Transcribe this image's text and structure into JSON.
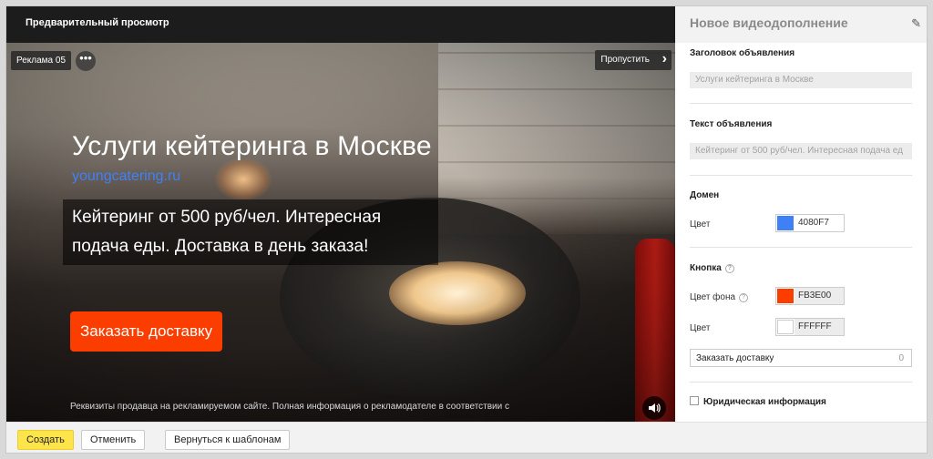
{
  "preview": {
    "header_title": "Предварительный просмотр",
    "ad_badge": "Реклама 05",
    "more_glyph": "•••",
    "skip_label": "Пропустить",
    "skip_icon": "chevron-right-icon",
    "title": "Услуги кейтеринга в Москве",
    "domain": "youngcatering.ru",
    "text": "Кейтеринг от 500 руб/чел. Интересная подача еды. Доставка в день заказа!",
    "cta": "Заказать доставку",
    "legal": "Реквизиты продавца на рекламируемом сайте. Полная информация о рекламодателе в соответствии с",
    "sound_icon": "speaker-icon"
  },
  "panel": {
    "title": "Новое видеодополнение",
    "edit_icon": "pencil-icon",
    "headline_label": "Заголовок объявления",
    "headline_placeholder": "Услуги кейтеринга в Москве",
    "text_label": "Текст объявления",
    "text_placeholder": "Кейтеринг от 500 руб/чел. Интересная подача ед",
    "domain_section": "Домен",
    "domain_color_label": "Цвет",
    "domain_color": "4080F7",
    "button_section": "Кнопка",
    "bg_color_label": "Цвет фона",
    "bg_color": "FB3E00",
    "text_color_label": "Цвет",
    "text_color": "FFFFFF",
    "button_text": "Заказать доставку",
    "button_text_count": "0",
    "legal_checkbox": "Юридическая информация"
  },
  "footer": {
    "create": "Создать",
    "cancel": "Отменить",
    "back": "Вернуться к шаблонам"
  },
  "colors": {
    "domain": "#4080f7",
    "cta_bg": "#fb3e00",
    "cta_text": "#ffffff",
    "primary_button": "#fde44b"
  }
}
